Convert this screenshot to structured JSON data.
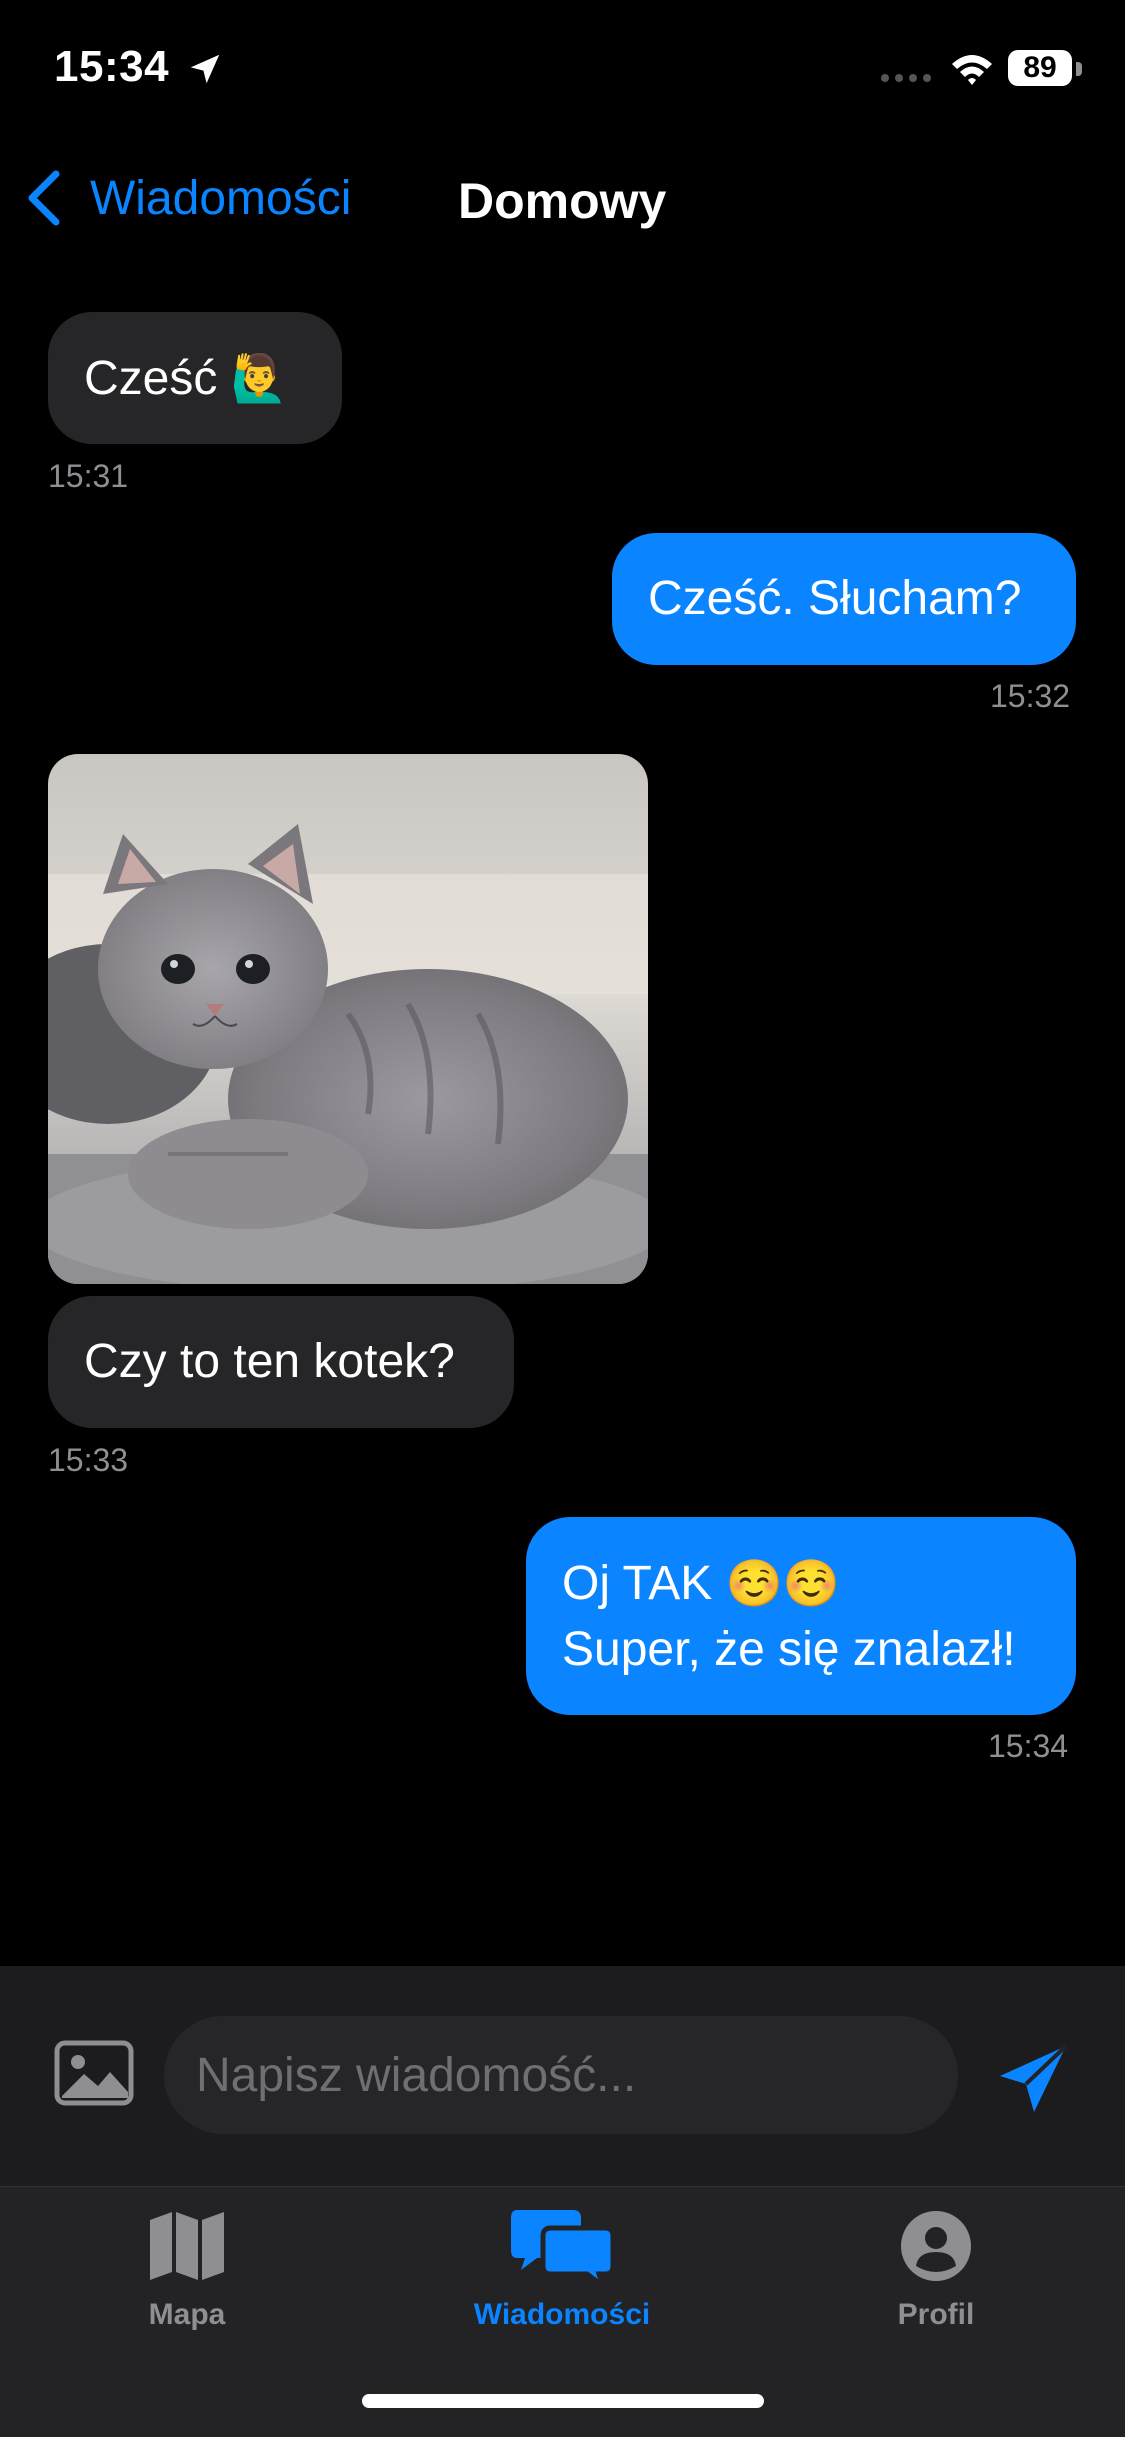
{
  "status_bar": {
    "time": "15:34",
    "battery": "89"
  },
  "nav": {
    "back_label": "Wiadomości",
    "title": "Domowy"
  },
  "messages": [
    {
      "direction": "in",
      "text": "Cześć",
      "emoji": "🙋‍♂️",
      "time": "15:31"
    },
    {
      "direction": "out",
      "text": "Cześć. Słucham?",
      "time": "15:32"
    },
    {
      "direction": "in",
      "type": "image",
      "text": "Czy to ten kotek?",
      "time": "15:33"
    },
    {
      "direction": "out",
      "line1": "Oj TAK",
      "line1_emoji": "☺️☺️",
      "line2": "Super, że się znalazł!",
      "time": "15:34"
    }
  ],
  "composer": {
    "placeholder": "Napisz wiadomość..."
  },
  "tabs": [
    {
      "label": "Mapa",
      "icon": "map-icon",
      "active": false
    },
    {
      "label": "Wiadomości",
      "icon": "chat-bubbles-icon",
      "active": true
    },
    {
      "label": "Profil",
      "icon": "person-icon",
      "active": false
    }
  ],
  "colors": {
    "accent": "#0a84ff",
    "incoming_bubble": "#262628",
    "background": "#000000"
  }
}
